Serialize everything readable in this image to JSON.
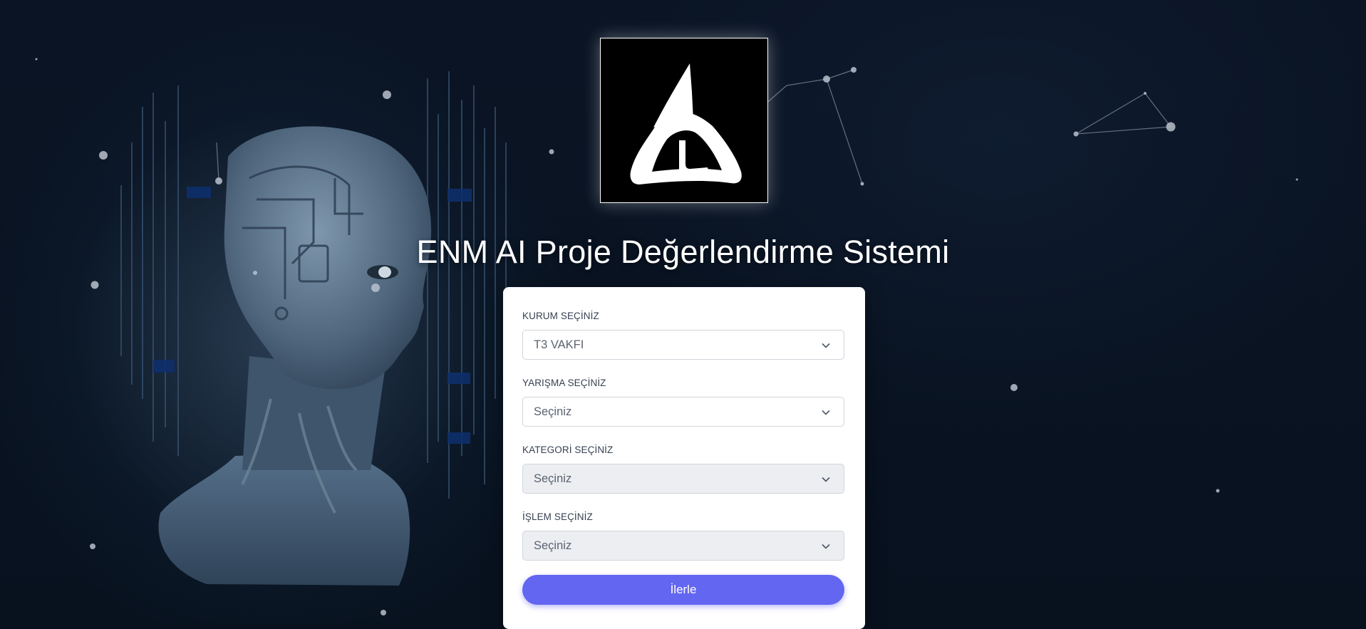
{
  "page": {
    "title": "ENM AI Proje Değerlendirme Sistemi",
    "logo_icon": "enm-triangle-logo-icon",
    "background_image": "ai-robot-head-circuit-illustration"
  },
  "form": {
    "fields": [
      {
        "label": "KURUM SEÇİNİZ",
        "value": "T3 VAKFI",
        "disabled": false
      },
      {
        "label": "YARIŞMA SEÇİNİZ",
        "value": "Seçiniz",
        "disabled": false
      },
      {
        "label": "KATEGORİ SEÇİNİZ",
        "value": "Seçiniz",
        "disabled": true
      },
      {
        "label": "İŞLEM SEÇİNİZ",
        "value": "Seçiniz",
        "disabled": true
      }
    ],
    "submit_label": "İlerle"
  },
  "colors": {
    "background": "#08121f",
    "card": "#ffffff",
    "primary_button": "#6366f1",
    "disabled_field": "#eceef2"
  }
}
